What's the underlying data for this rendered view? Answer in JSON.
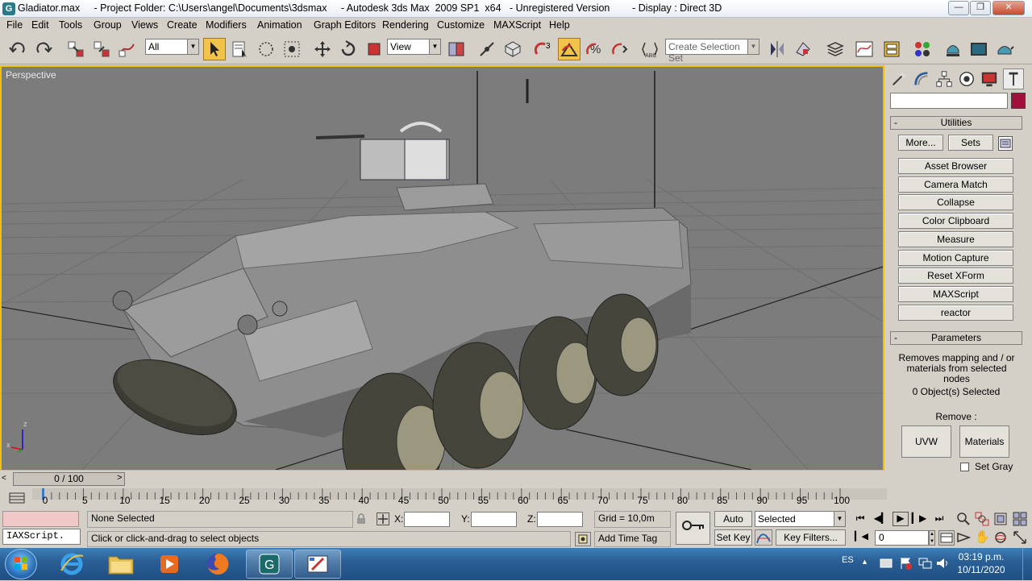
{
  "window": {
    "title": "Gladiator.max     - Project Folder: C:\\Users\\angel\\Documents\\3dsmax     - Autodesk 3ds Max  2009 SP1  x64   - Unregistered Version        - Display : Direct 3D",
    "app_icon": "G"
  },
  "menu": [
    "File",
    "Edit",
    "Tools",
    "Group",
    "Views",
    "Create",
    "Modifiers",
    "Animation",
    "Graph Editors",
    "Rendering",
    "Customize",
    "MAXScript",
    "Help"
  ],
  "toolbar": {
    "selection_filter": "All",
    "ref_coord": "View",
    "snap_label": "3",
    "named_selection_placeholder": "Create Selection Set"
  },
  "viewport": {
    "label": "Perspective",
    "axis_z": "z",
    "axis_x": "x"
  },
  "command_panel": {
    "utilities_title": "Utilities",
    "more_button": "More...",
    "sets_button": "Sets",
    "utility_buttons": [
      "Asset Browser",
      "Camera Match",
      "Collapse",
      "Color Clipboard",
      "Measure",
      "Motion Capture",
      "Reset XForm",
      "MAXScript",
      "reactor"
    ],
    "parameters_title": "Parameters",
    "description": "Removes mapping and / or materials from selected nodes",
    "selected_count": "0 Object(s) Selected",
    "remove_label": "Remove :",
    "uvw_button": "UVW",
    "materials_button": "Materials",
    "set_gray_label": "Set Gray",
    "object_color": "#a0103a"
  },
  "timeline": {
    "frame_display": "0 / 100",
    "ticks": [
      "0",
      "5",
      "10",
      "15",
      "20",
      "25",
      "30",
      "35",
      "40",
      "45",
      "50",
      "55",
      "60",
      "65",
      "70",
      "75",
      "80",
      "85",
      "90",
      "95",
      "100"
    ]
  },
  "status": {
    "maxscript_listener": "IAXScript.",
    "selection_text": "None Selected",
    "prompt_text": "Click or click-and-drag to select objects",
    "x_label": "X:",
    "y_label": "Y:",
    "z_label": "Z:",
    "grid_text": "Grid = 10,0m",
    "add_time_tag": "Add Time Tag",
    "auto_key": "Auto Key",
    "set_key": "Set Key",
    "key_mode": "Selected",
    "key_filters": "Key Filters...",
    "current_frame": "0"
  },
  "taskbar": {
    "language": "ES",
    "time": "03:19 p.m.",
    "date": "10/11/2020"
  }
}
